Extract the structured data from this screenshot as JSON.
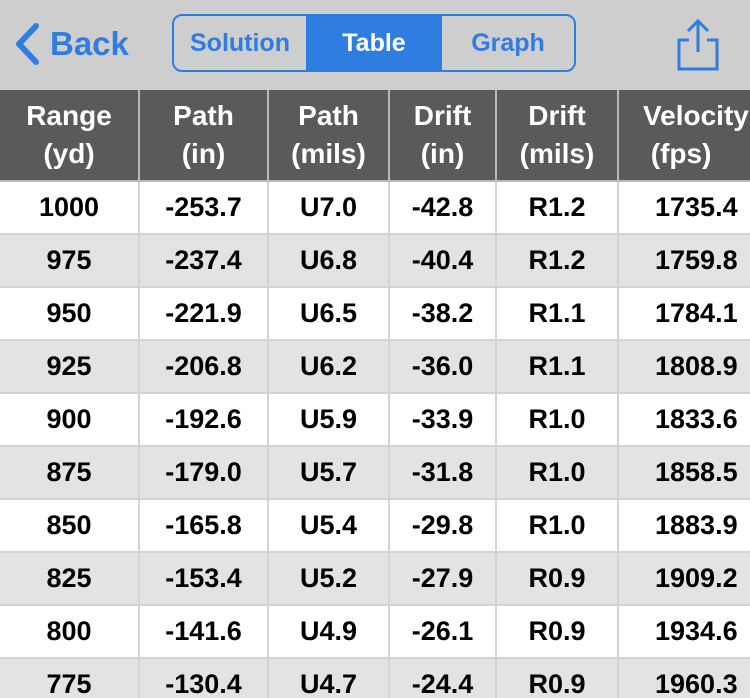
{
  "nav": {
    "back_label": "Back",
    "segments": [
      "Solution",
      "Table",
      "Graph"
    ],
    "active_segment": "Table"
  },
  "table": {
    "headers": [
      {
        "line1": "Range",
        "line2": "(yd)"
      },
      {
        "line1": "Path",
        "line2": "(in)"
      },
      {
        "line1": "Path",
        "line2": "(mils)"
      },
      {
        "line1": "Drift",
        "line2": "(in)"
      },
      {
        "line1": "Drift",
        "line2": "(mils)"
      },
      {
        "line1": "Velocity",
        "line2": "(fps)"
      }
    ],
    "rows": [
      [
        "1000",
        "-253.7",
        "U7.0",
        "-42.8",
        "R1.2",
        "1735.4"
      ],
      [
        "975",
        "-237.4",
        "U6.8",
        "-40.4",
        "R1.2",
        "1759.8"
      ],
      [
        "950",
        "-221.9",
        "U6.5",
        "-38.2",
        "R1.1",
        "1784.1"
      ],
      [
        "925",
        "-206.8",
        "U6.2",
        "-36.0",
        "R1.1",
        "1808.9"
      ],
      [
        "900",
        "-192.6",
        "U5.9",
        "-33.9",
        "R1.0",
        "1833.6"
      ],
      [
        "875",
        "-179.0",
        "U5.7",
        "-31.8",
        "R1.0",
        "1858.5"
      ],
      [
        "850",
        "-165.8",
        "U5.4",
        "-29.8",
        "R1.0",
        "1883.9"
      ],
      [
        "825",
        "-153.4",
        "U5.2",
        "-27.9",
        "R0.9",
        "1909.2"
      ],
      [
        "800",
        "-141.6",
        "U4.9",
        "-26.1",
        "R0.9",
        "1934.6"
      ],
      [
        "775",
        "-130.4",
        "U4.7",
        "-24.4",
        "R0.9",
        "1960.3"
      ]
    ]
  },
  "colors": {
    "accent": "#2f7de1",
    "nav_bg": "#cecece",
    "header_bg": "#5a5a5a",
    "row_alt": "#e3e3e3"
  },
  "icons": {
    "back": "chevron-left-icon",
    "share": "share-icon"
  }
}
